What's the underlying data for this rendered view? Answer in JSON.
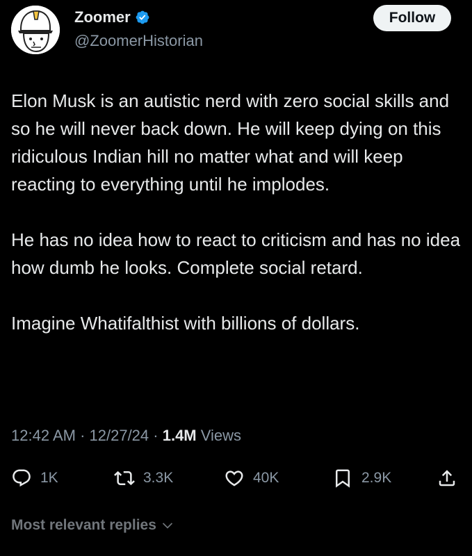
{
  "author": {
    "name": "Zoomer",
    "handle": "@ZoomerHistorian",
    "verified_color": "#1d9bf0"
  },
  "follow_button_label": "Follow",
  "tweet": {
    "paragraphs": [
      "Elon Musk is an autistic nerd with zero social skills and so he will never back down. He will keep dying on this ridiculous Indian hill no matter what and will keep reacting to everything until he implodes.",
      "He has no idea how to react to criticism and has no idea how dumb he looks. Complete social retard.",
      "Imagine Whatifalthist with billions of dollars."
    ]
  },
  "meta": {
    "time": "12:42 AM",
    "sep1": " · ",
    "date": "12/27/24",
    "sep2": " · ",
    "views_count": "1.4M",
    "views_label": " Views"
  },
  "actions": {
    "replies": {
      "icon": "reply-icon",
      "count": "1K"
    },
    "reposts": {
      "icon": "repost-icon",
      "count": "3.3K"
    },
    "likes": {
      "icon": "like-icon",
      "count": "40K"
    },
    "bookmarks": {
      "icon": "bookmark-icon",
      "count": "2.9K"
    },
    "share": {
      "icon": "share-icon"
    }
  },
  "replies_sort_label": "Most relevant replies"
}
